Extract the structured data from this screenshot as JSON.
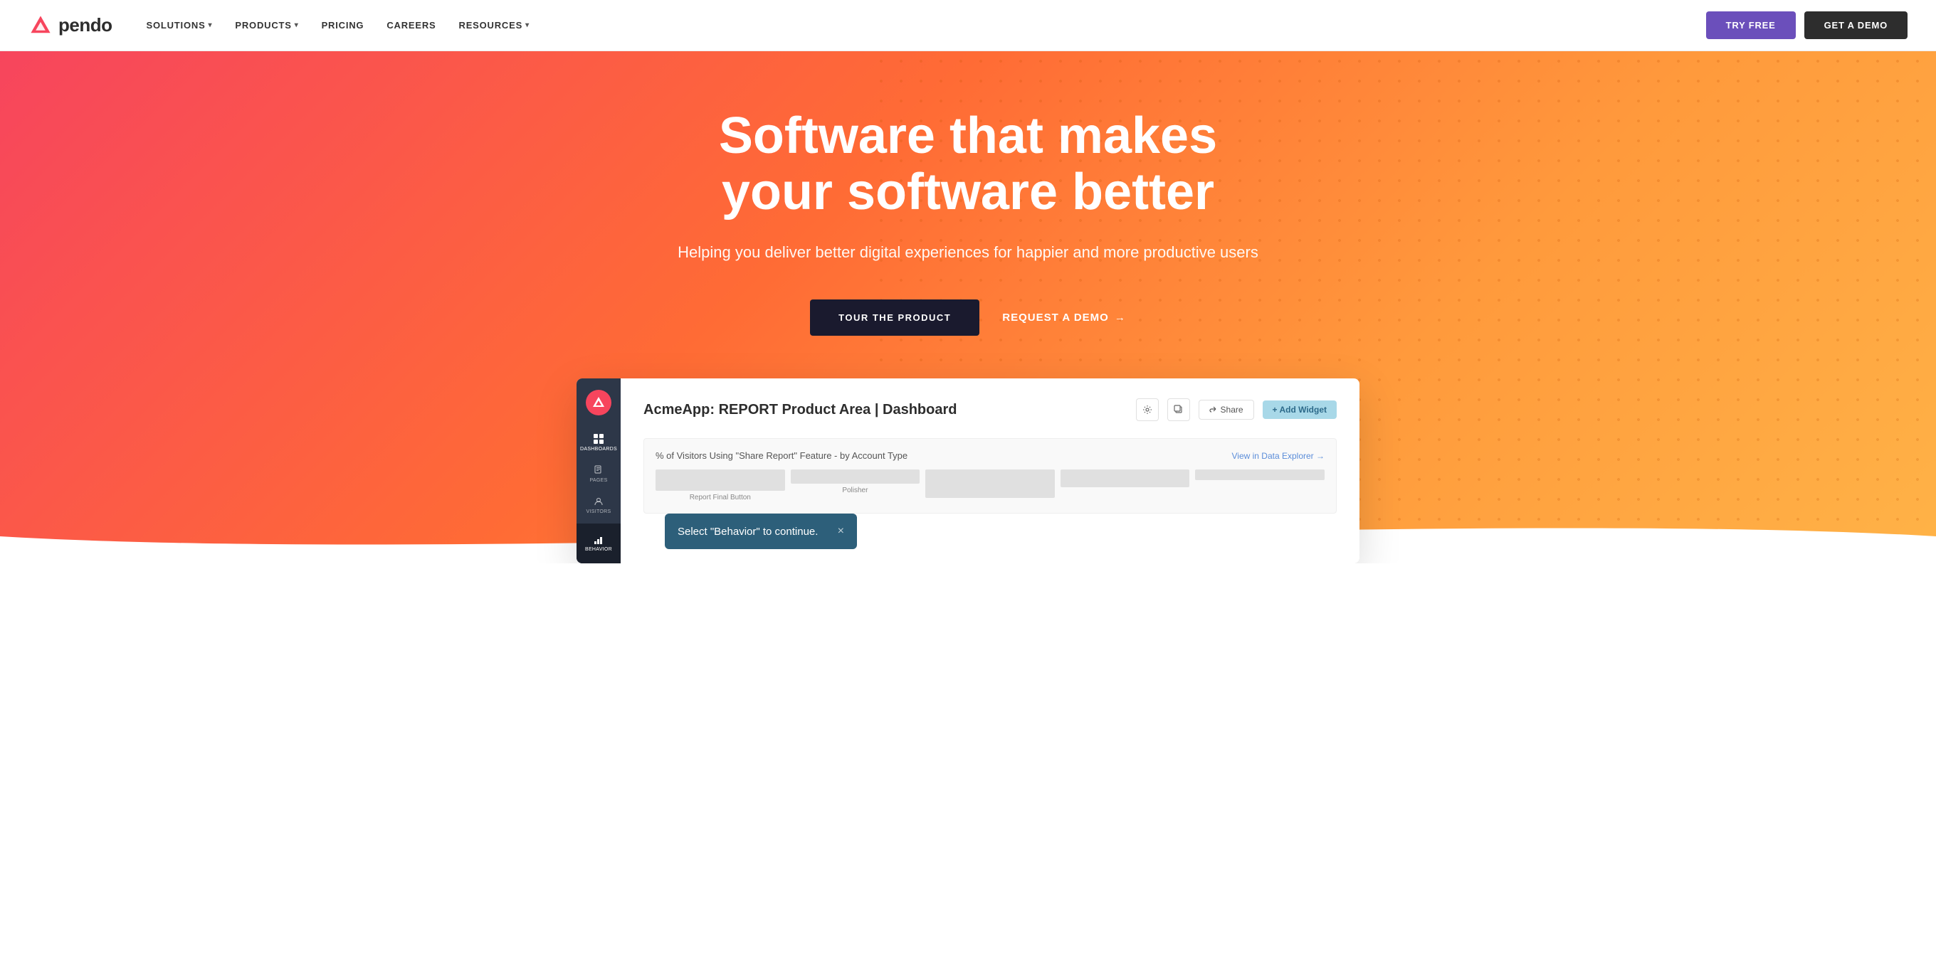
{
  "nav": {
    "logo_text": "pendo",
    "links": [
      {
        "label": "SOLUTIONS",
        "has_dropdown": true
      },
      {
        "label": "PRODUCTS",
        "has_dropdown": true
      },
      {
        "label": "PRICING",
        "has_dropdown": false
      },
      {
        "label": "CAREERS",
        "has_dropdown": false
      },
      {
        "label": "RESOURCES",
        "has_dropdown": true
      }
    ],
    "try_free_label": "TRY FREE",
    "get_demo_label": "GET A DEMO"
  },
  "hero": {
    "title": "Software that makes your software better",
    "subtitle": "Helping you deliver better digital experiences for happier and more productive users",
    "cta_tour": "TOUR THE PRODUCT",
    "cta_demo": "REQUEST A DEMO",
    "cta_demo_arrow": "→"
  },
  "dashboard": {
    "title": "AcmeApp: REPORT Product Area | Dashboard",
    "share_label": "Share",
    "add_widget_label": "+ Add Widget",
    "chart_title": "% of Visitors Using \"Share Report\" Feature - by Account Type",
    "chart_link": "View in Data Explorer →",
    "col_labels": [
      "Report Final Button",
      "Polisher"
    ],
    "sidebar_items": [
      {
        "label": "Dashboards",
        "active": true
      },
      {
        "label": "Pages",
        "active": false
      },
      {
        "label": "Visitors",
        "active": false
      }
    ],
    "sidebar_behavior_label": "Behavior",
    "tooltip_text": "Select \"Behavior\" to continue.",
    "tooltip_close": "×"
  }
}
